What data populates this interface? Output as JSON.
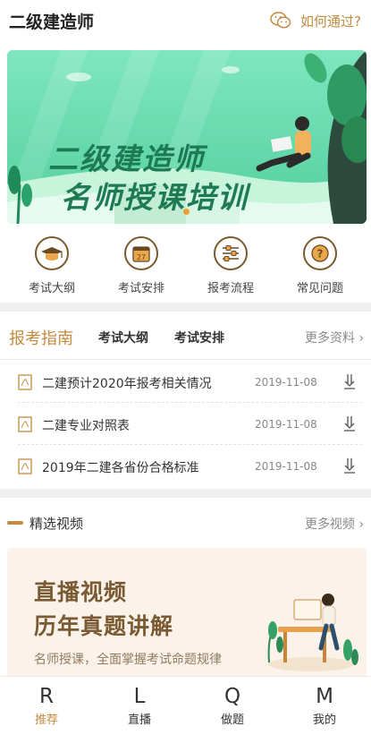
{
  "header": {
    "title": "二级建造师",
    "how_link": "如何通过?"
  },
  "banner": {
    "line1": "二级建造师",
    "line2": "名师授课培训",
    "page_indicator": {
      "current": 1,
      "total": 1
    }
  },
  "quick_nav": [
    {
      "label": "考试大纲",
      "icon": "graduation-cap-icon"
    },
    {
      "label": "考试安排",
      "icon": "calendar-icon"
    },
    {
      "label": "报考流程",
      "icon": "flow-steps-icon"
    },
    {
      "label": "常见问题",
      "icon": "question-icon"
    }
  ],
  "guide": {
    "tabs": [
      "报考指南",
      "考试大纲",
      "考试安排"
    ],
    "more": "更多资料 ›",
    "docs": [
      {
        "name": "二建预计2020年报考相关情况",
        "date": "2019-11-08"
      },
      {
        "name": "二建专业对照表",
        "date": "2019-11-08"
      },
      {
        "name": "2019年二建各省份合格标准",
        "date": "2019-11-08"
      }
    ]
  },
  "videos": {
    "title": "精选视频",
    "more": "更多视频 ›",
    "banner": {
      "line1": "直播视频",
      "line2": "历年真题讲解",
      "sub": "名师授课，全面掌握考试命题规律"
    }
  },
  "bottom_nav": [
    {
      "glyph": "R",
      "label": "推荐",
      "active": true
    },
    {
      "glyph": "L",
      "label": "直播",
      "active": false
    },
    {
      "glyph": "Q",
      "label": "做题",
      "active": false
    },
    {
      "glyph": "M",
      "label": "我的",
      "active": false
    }
  ],
  "colors": {
    "accent": "#c48a3f",
    "banner_green": "#5fd6a8",
    "text_dark": "#333333"
  }
}
